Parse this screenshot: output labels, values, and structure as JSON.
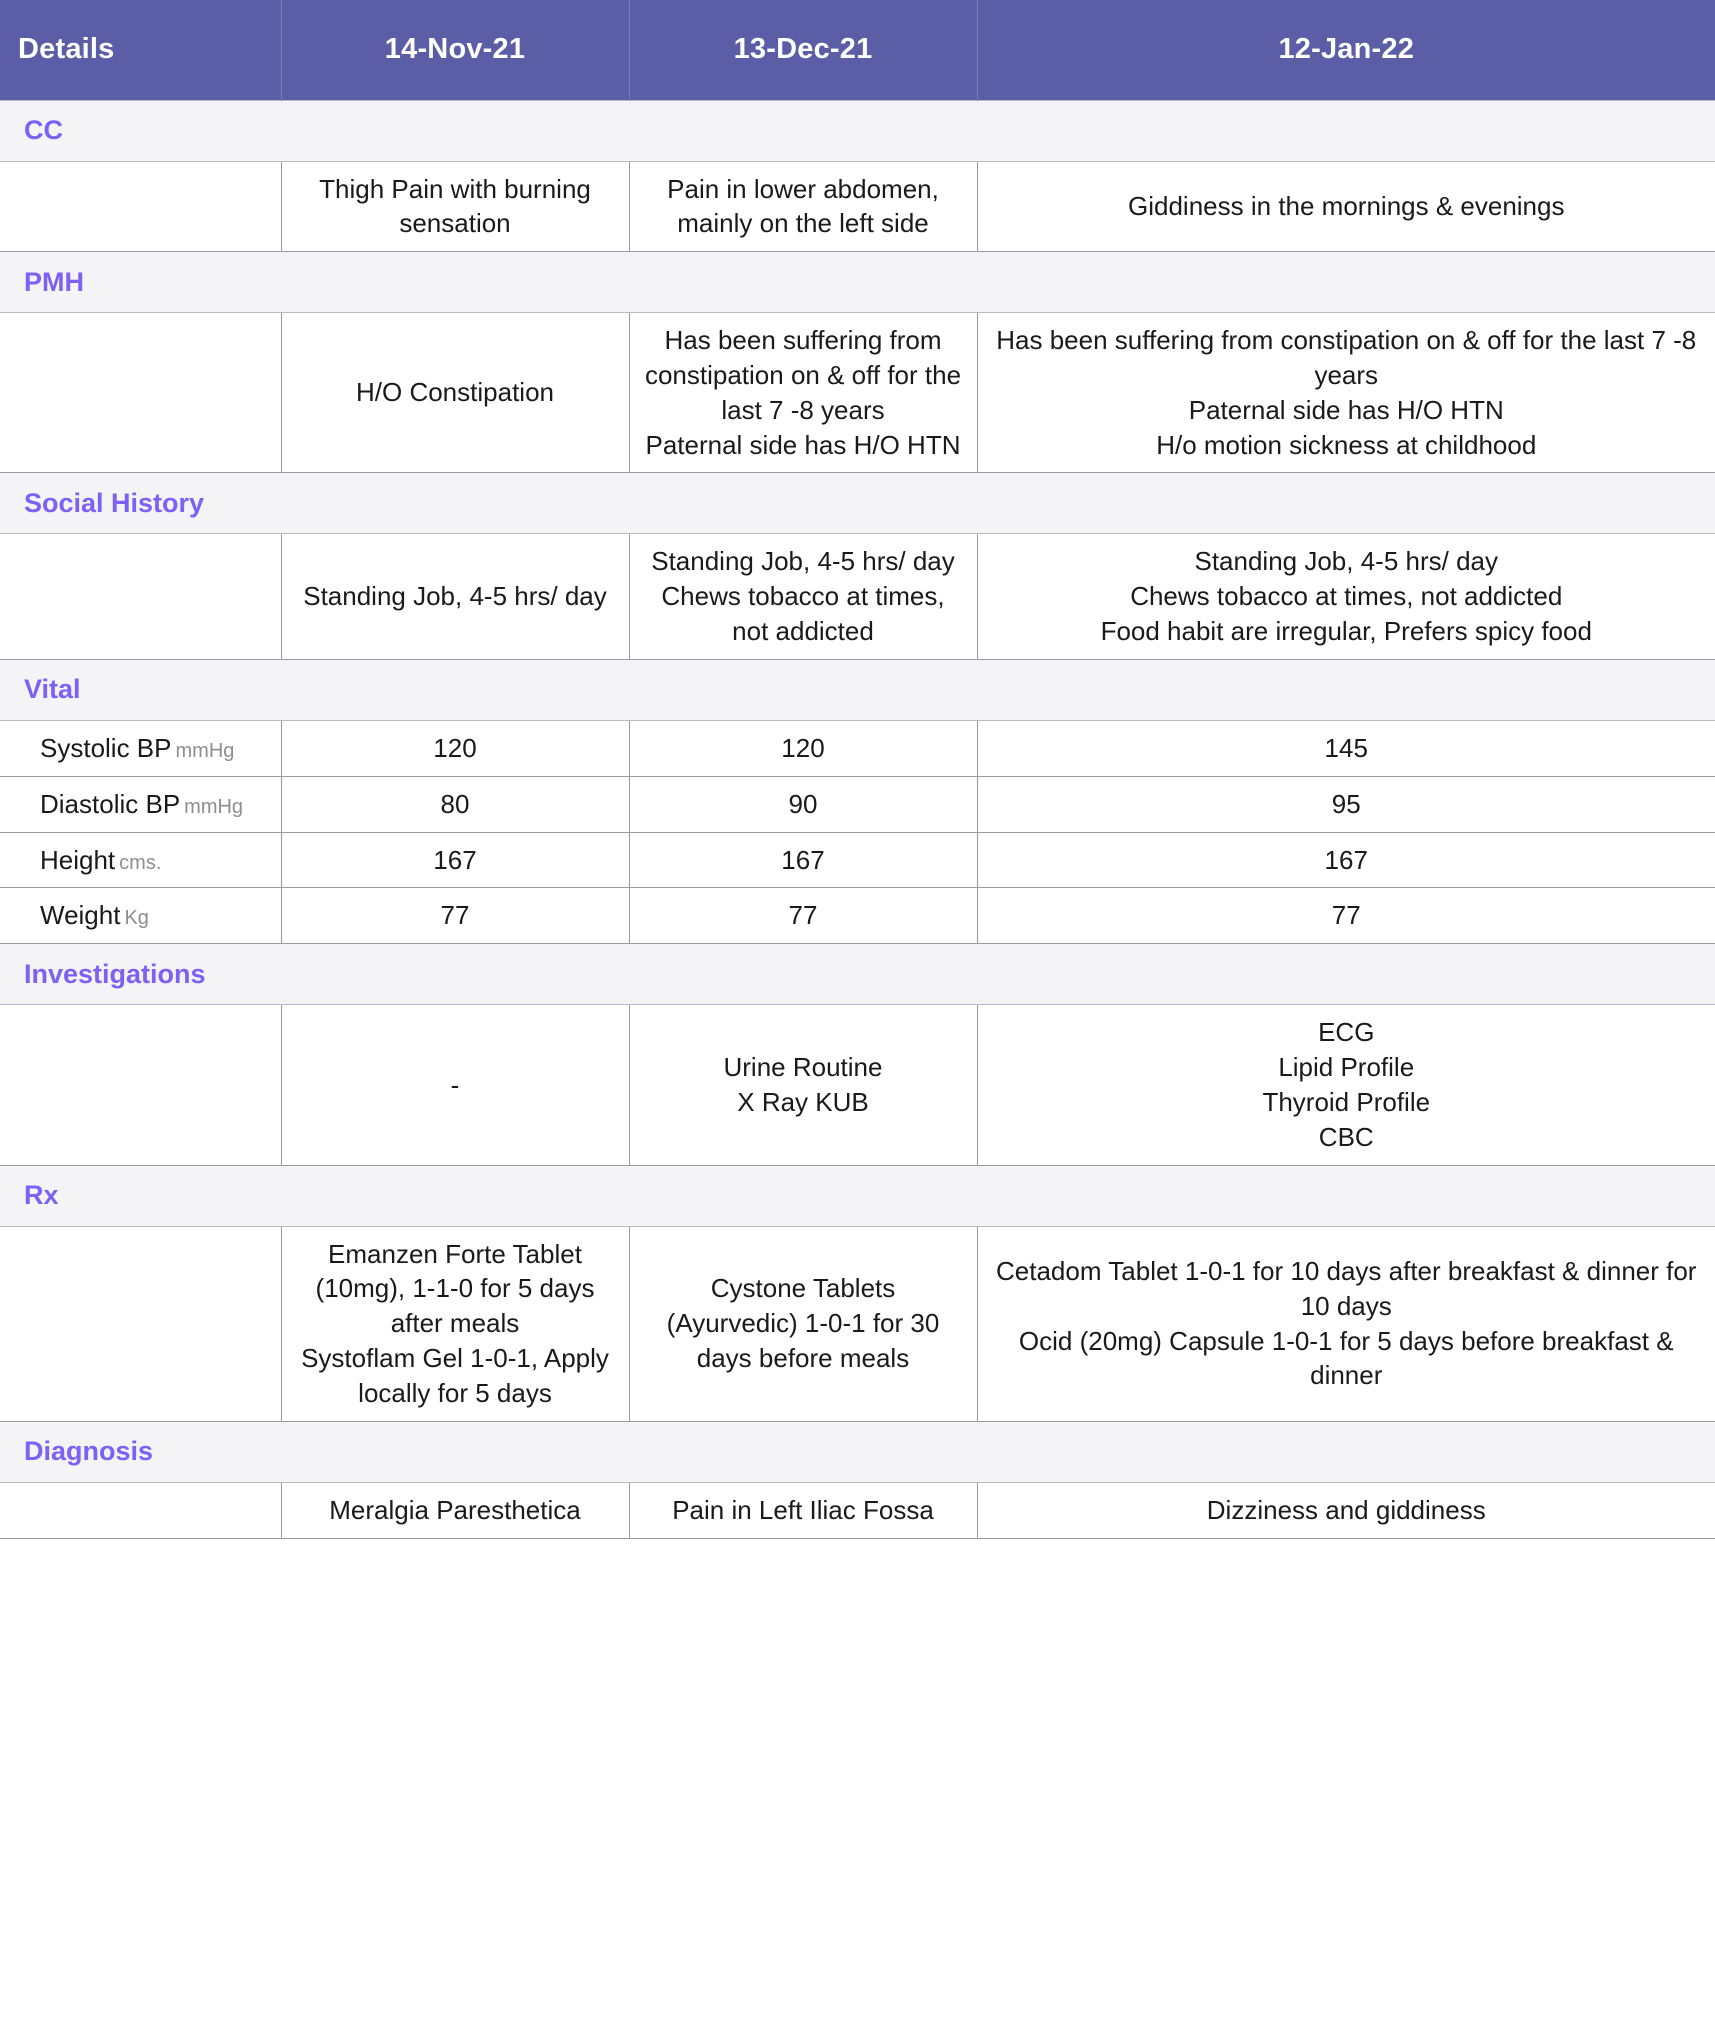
{
  "header": {
    "label_column": "Details",
    "dates": [
      "14-Nov-21",
      "13-Dec-21",
      "12-Jan-22"
    ]
  },
  "colors": {
    "header_bg": "#5b5ea6",
    "header_text": "#ffffff",
    "section_bg": "#f4f3f6",
    "section_text": "#7b61f5",
    "body_text": "#1a1a1a",
    "unit_text": "#8d8d92",
    "grid_line": "#9b9b9b"
  },
  "sections": [
    {
      "title": "CC",
      "rows": [
        {
          "label": "",
          "unit": "",
          "values": [
            "Thigh Pain with burning sensation",
            "Pain in lower abdomen, mainly on the left side",
            "Giddiness in the mornings & evenings"
          ]
        }
      ]
    },
    {
      "title": "PMH",
      "rows": [
        {
          "label": "",
          "unit": "",
          "values": [
            "H/O Constipation",
            "Has been suffering from constipation on & off for the last 7 -8 years\nPaternal side has H/O HTN",
            "Has been suffering from constipation on & off for the last 7 -8 years\nPaternal side has H/O HTN\nH/o motion sickness at childhood"
          ]
        }
      ]
    },
    {
      "title": "Social History",
      "rows": [
        {
          "label": "",
          "unit": "",
          "values": [
            "Standing Job, 4-5 hrs/ day",
            "Standing Job, 4-5 hrs/ day\nChews tobacco at times, not addicted",
            "Standing Job, 4-5 hrs/ day\nChews tobacco at times, not addicted\nFood habit are irregular, Prefers spicy food"
          ]
        }
      ]
    },
    {
      "title": "Vital",
      "rows": [
        {
          "label": "Systolic BP",
          "unit": "mmHg",
          "values": [
            "120",
            "120",
            "145"
          ]
        },
        {
          "label": "Diastolic BP",
          "unit": "mmHg",
          "values": [
            "80",
            "90",
            "95"
          ]
        },
        {
          "label": "Height",
          "unit": "cms.",
          "values": [
            "167",
            "167",
            "167"
          ]
        },
        {
          "label": "Weight",
          "unit": "Kg",
          "values": [
            "77",
            "77",
            "77"
          ]
        }
      ]
    },
    {
      "title": "Investigations",
      "rows": [
        {
          "label": "",
          "unit": "",
          "values": [
            "-",
            "Urine Routine\nX Ray KUB",
            "ECG\nLipid Profile\nThyroid Profile\nCBC"
          ]
        }
      ]
    },
    {
      "title": "Rx",
      "rows": [
        {
          "label": "",
          "unit": "",
          "values": [
            "Emanzen Forte Tablet (10mg), 1-1-0 for 5 days after meals\nSystoflam Gel 1-0-1, Apply locally for 5 days",
            "Cystone Tablets (Ayurvedic) 1-0-1 for 30 days before meals",
            "Cetadom Tablet 1-0-1 for 10 days after breakfast & dinner for 10 days\nOcid (20mg) Capsule 1-0-1 for 5 days before breakfast & dinner"
          ]
        }
      ]
    },
    {
      "title": "Diagnosis",
      "rows": [
        {
          "label": "",
          "unit": "",
          "values": [
            "Meralgia Paresthetica",
            "Pain in Left Iliac Fossa",
            "Dizziness and giddiness"
          ]
        }
      ]
    }
  ]
}
